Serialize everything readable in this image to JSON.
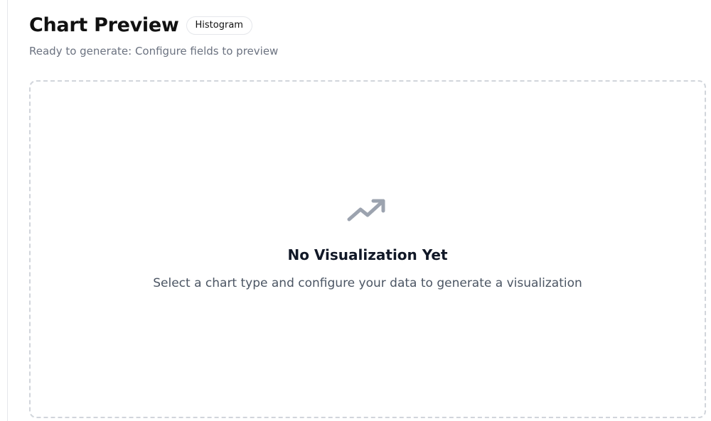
{
  "header": {
    "title": "Chart Preview",
    "badge": "Histogram"
  },
  "status": {
    "text": "Ready to generate: Configure fields to preview"
  },
  "empty_state": {
    "icon": "trending-up-icon",
    "title": "No Visualization Yet",
    "description": "Select a chart type and configure your data to generate a visualization"
  },
  "colors": {
    "icon": "#9ca3af",
    "border": "#d1d5db",
    "muted_text": "#6b7280"
  }
}
